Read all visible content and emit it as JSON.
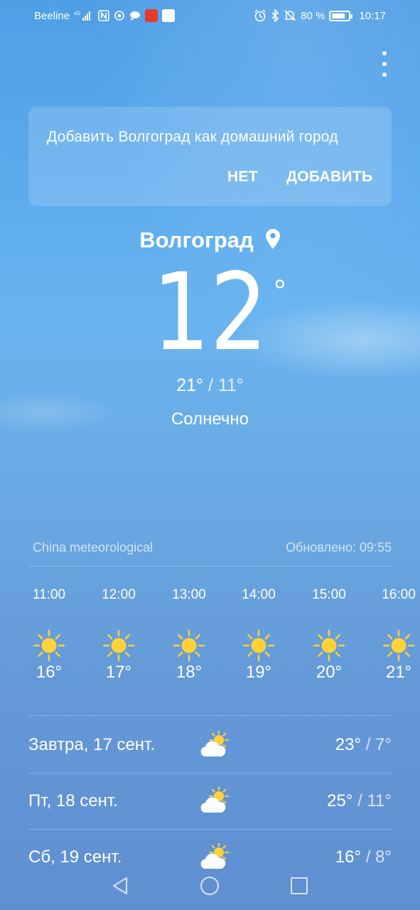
{
  "status_bar": {
    "carrier": "Beeline",
    "network": "4G",
    "battery_percent": "80 %",
    "battery_level": 0.8,
    "time": "10:17",
    "icons": [
      "signal-icon",
      "nfc-icon",
      "location-target-icon",
      "chat-icon",
      "app-badge-icon",
      "app-badge-icon",
      "alarm-icon",
      "bluetooth-icon",
      "mute-icon",
      "battery-icon"
    ]
  },
  "add_home_card": {
    "message": "Добавить Волгоград как домашний город",
    "no_label": "НЕТ",
    "add_label": "ДОБАВИТЬ"
  },
  "current": {
    "city": "Волгоград",
    "temperature": "12",
    "degree_symbol": "°",
    "high": "21°",
    "separator": " / ",
    "low": "11°",
    "condition": "Солнечно"
  },
  "source": {
    "provider": "China meteorological",
    "updated": "Обновлено: 09:55"
  },
  "hourly": [
    {
      "time": "11:00",
      "temp": "16°",
      "icon": "sun-icon"
    },
    {
      "time": "12:00",
      "temp": "17°",
      "icon": "sun-icon"
    },
    {
      "time": "13:00",
      "temp": "18°",
      "icon": "sun-icon"
    },
    {
      "time": "14:00",
      "temp": "19°",
      "icon": "sun-icon"
    },
    {
      "time": "15:00",
      "temp": "20°",
      "icon": "sun-icon"
    },
    {
      "time": "16:00",
      "temp": "21°",
      "icon": "sun-icon"
    }
  ],
  "daily": [
    {
      "label": "Завтра, 17 сент.",
      "high": "23°",
      "separator": " / ",
      "low": "7°",
      "icon": "partly-cloudy-icon"
    },
    {
      "label": "Пт, 18 сент.",
      "high": "25°",
      "separator": " / ",
      "low": "11°",
      "icon": "partly-cloudy-icon"
    },
    {
      "label": "Сб, 19 сент.",
      "high": "16°",
      "separator": " / ",
      "low": "8°",
      "icon": "partly-cloudy-icon"
    }
  ],
  "colors": {
    "sky_top": "#4f9fe6",
    "sky_bottom": "#5f8fd0",
    "sun": "#ffd23a",
    "text": "#ffffff"
  }
}
